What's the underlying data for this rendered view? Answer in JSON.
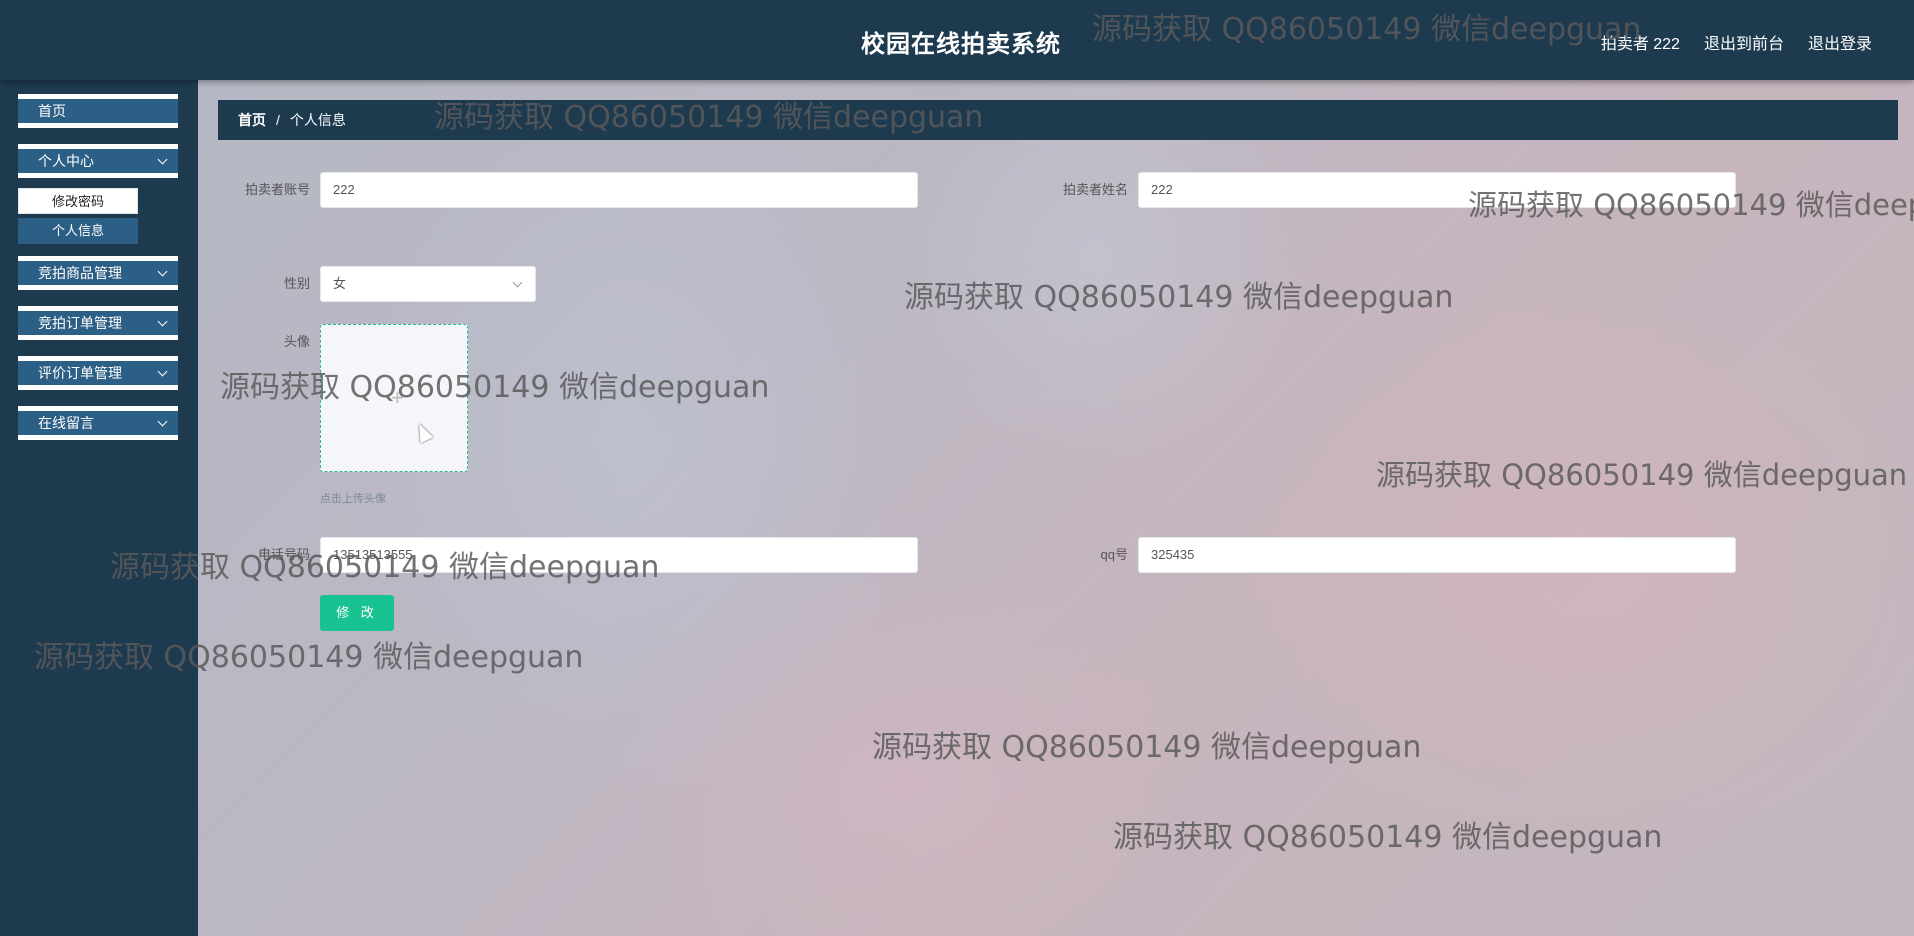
{
  "header": {
    "title": "校园在线拍卖系统",
    "user_label": "拍卖者 222",
    "to_frontend": "退出到前台",
    "logout": "退出登录"
  },
  "sidebar": {
    "items": [
      {
        "label": "首页"
      },
      {
        "label": "个人中心"
      },
      {
        "label": "竞拍商品管理"
      },
      {
        "label": "竞拍订单管理"
      },
      {
        "label": "评价订单管理"
      },
      {
        "label": "在线留言"
      }
    ],
    "sub_items": [
      {
        "label": "修改密码"
      },
      {
        "label": "个人信息"
      }
    ]
  },
  "breadcrumb": {
    "home": "首页",
    "separator": "/",
    "current": "个人信息"
  },
  "form": {
    "account_label": "拍卖者账号",
    "account_value": "222",
    "name_label": "拍卖者姓名",
    "name_value": "222",
    "gender_label": "性别",
    "gender_value": "女",
    "avatar_label": "头像",
    "avatar_plus": "+",
    "avatar_hint": "点击上传头像",
    "phone_label": "电话号码",
    "phone_value": "13513513555",
    "qq_label": "qq号",
    "qq_value": "325435",
    "submit_label": "修 改"
  },
  "watermark_text": "源码获取 QQ86050149 微信deepguan"
}
